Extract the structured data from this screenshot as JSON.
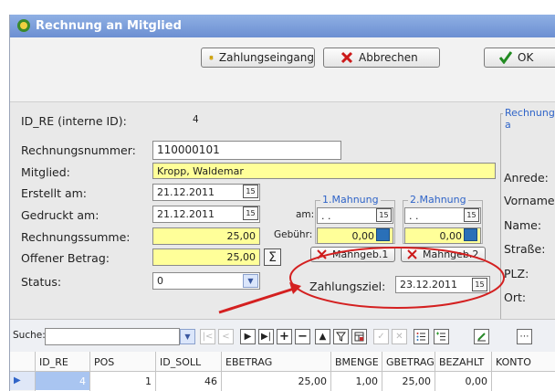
{
  "window": {
    "title": "Rechnung an Mitglied"
  },
  "toolbar": {
    "zahlung_label": "Zahlungseingang",
    "abbrechen_label": "Abbrechen",
    "ok_label": "OK"
  },
  "form": {
    "id_label": "ID_RE (interne ID):",
    "id_value": "4",
    "rechnungsnummer_label": "Rechnungsnummer:",
    "rechnungsnummer_value": "110000101",
    "mitglied_label": "Mitglied:",
    "mitglied_value": "Kropp, Waldemar",
    "erstellt_label": "Erstellt am:",
    "erstellt_value": "21.12.2011",
    "gedruckt_label": "Gedruckt am:",
    "gedruckt_value": "21.12.2011",
    "summe_label": "Rechnungssumme:",
    "summe_value": "25,00",
    "offen_label": "Offener Betrag:",
    "offen_value": "25,00",
    "status_label": "Status:",
    "status_value": "0",
    "am_label": "am:",
    "gebuehr_label": "Gebühr:",
    "mahnung1_title": "1.Mahnung",
    "mahnung1_date": ". .",
    "mahnung1_fee": "0,00",
    "mahngeb1_label": "Mahngeb.1",
    "mahnung2_title": "2.Mahnung",
    "mahnung2_date": ". .",
    "mahnung2_fee": "0,00",
    "mahngeb2_label": "Mahngeb.2",
    "zahlungsziel_label": "Zahlungsziel:",
    "zahlungsziel_value": "23.12.2011",
    "sum_symbol": "Σ"
  },
  "right_panel": {
    "group_title": "Rechnung a",
    "fields": [
      "Anrede:",
      "Vorname:",
      "Name:",
      "Straße:",
      "PLZ:",
      "Ort:"
    ]
  },
  "search": {
    "label": "Suche:",
    "value": ""
  },
  "grid": {
    "columns": [
      "ID_RE",
      "POS",
      "ID_SOLL",
      "EBETRAG",
      "BMENGE",
      "GBETRAG",
      "BEZAHLT",
      "KONTO"
    ],
    "row": [
      "4",
      "1",
      "46",
      "25,00",
      "1,00",
      "25,00",
      "0,00",
      ""
    ]
  },
  "colors": {
    "highlight": "#ffff99",
    "annotation": "#d42020",
    "accent": "#2f64c8"
  }
}
